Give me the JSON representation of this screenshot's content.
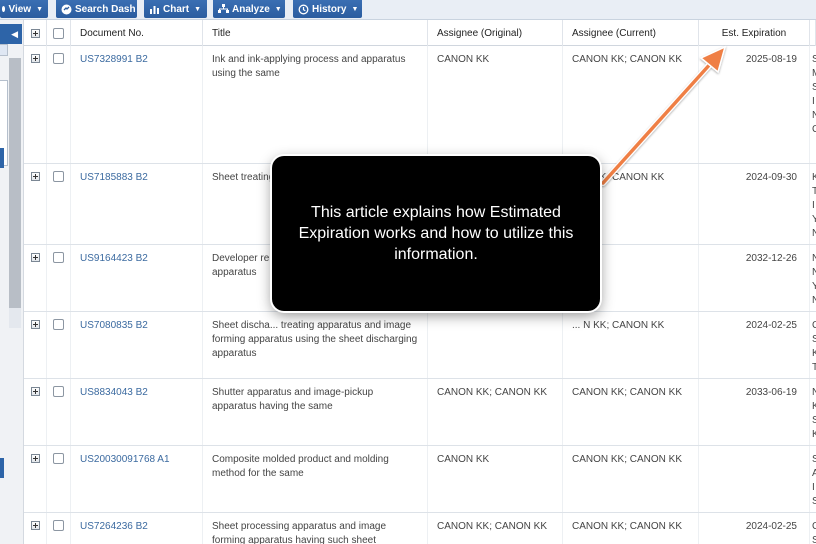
{
  "toolbar": {
    "view_label": "View",
    "search_dash_label": "Search Dash",
    "chart_label": "Chart",
    "analyze_label": "Analyze",
    "history_label": "History"
  },
  "table": {
    "columns": {
      "document_no": "Document No.",
      "title": "Title",
      "assignee_original": "Assignee (Original)",
      "assignee_current": "Assignee (Current)",
      "est_expiration": "Est. Expiration"
    },
    "rows": [
      {
        "doc": "US7328991 B2",
        "title": "Ink and ink-applying process and apparatus using the same",
        "assignee_original": "CANON KK",
        "assignee_current": "CANON KK; CANON KK",
        "expiration": "2025-08-19",
        "extra": [
          "S",
          "M",
          "S",
          "I",
          "N",
          "C"
        ]
      },
      {
        "doc": "US7185883 B2",
        "title": "Sheet treating ... apparatus",
        "assignee_original": "",
        "assignee_current": "... N KK; CANON KK",
        "expiration": "2024-09-30",
        "extra": [
          "K",
          "T",
          "I",
          "Y",
          "N"
        ]
      },
      {
        "doc": "US9164423 B2",
        "title": "Developer re... accommodat... replenishmen... apparatus",
        "assignee_original": "",
        "assignee_current": "",
        "expiration": "2032-12-26",
        "extra": [
          "N",
          "N",
          "Y",
          "N"
        ]
      },
      {
        "doc": "US7080835 B2",
        "title": "Sheet discha... treating apparatus and image forming apparatus using the sheet discharging apparatus",
        "assignee_original": "",
        "assignee_current": "... N KK; CANON KK",
        "expiration": "2024-02-25",
        "extra": [
          "C",
          "S",
          "K",
          "T"
        ]
      },
      {
        "doc": "US8834043 B2",
        "title": "Shutter apparatus and image-pickup apparatus having the same",
        "assignee_original": "CANON KK; CANON KK",
        "assignee_current": "CANON KK; CANON KK",
        "expiration": "2033-06-19",
        "extra": [
          "N",
          "K",
          "S",
          "K"
        ]
      },
      {
        "doc": "US20030091768 A1",
        "title": "Composite molded product and molding method for the same",
        "assignee_original": "CANON KK",
        "assignee_current": "CANON KK; CANON KK",
        "expiration": "",
        "extra": [
          "S",
          "A",
          "I",
          "S"
        ]
      },
      {
        "doc": "US7264236 B2",
        "title": "Sheet processing apparatus and image forming apparatus having such sheet processing apparatus",
        "assignee_original": "CANON KK; CANON KK",
        "assignee_current": "CANON KK; CANON KK",
        "expiration": "2024-02-25",
        "extra": [
          "C",
          "S",
          "K"
        ]
      }
    ]
  },
  "callout": {
    "text": "This article explains how Estimated Expiration works and how to utilize this information."
  },
  "colors": {
    "toolbar_button": "#2b5d9f",
    "link": "#3b6aa0",
    "arrow": "#ef7f45",
    "callout_bg": "#000000"
  },
  "icons": [
    "view-icon",
    "search-dash-icon",
    "chart-icon",
    "analyze-icon",
    "history-icon",
    "expand-icon",
    "checkbox-icon"
  ]
}
